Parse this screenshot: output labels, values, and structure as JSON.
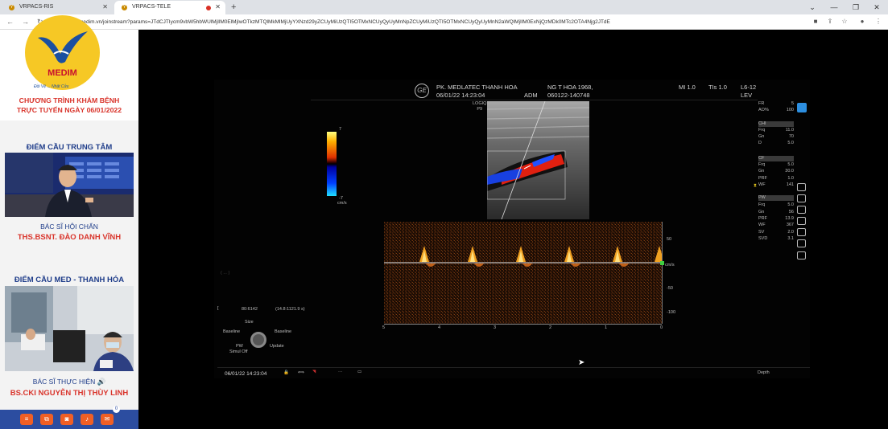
{
  "browser": {
    "tabs": [
      {
        "label": "VRPACS-RIS"
      },
      {
        "label": "VRPACS-TELE"
      }
    ],
    "url": "medim.vn/joinstream?params=JTdCJTIycm9vbW5hbWUlMjIlM0ElMjIwOTkzMTQlMkMlMjUyYXNzd29yZCUyMiUzQTI5OTMxNCUyQyUyMnNpZCUyMiUzQTI5OTMxNCUyQyUyMnN2aWQlMjIlM0ExNjQzMDk0MTc2OTA4Njg2JTdE"
  },
  "left_panel": {
    "logo_text": "MEDIM",
    "slogan": "Đồi Vệ ... Nhật Cửu",
    "program_line1": "CHƯƠNG TRÌNH KHÁM BỆNH",
    "program_line2": "TRỰC TUYẾN NGÀY 06/01/2022",
    "center_title": "ĐIỂM CẦU TRUNG TÂM",
    "center_role": "BÁC SĨ HỘI CHẨN",
    "center_doctor": "THS.BSNT. ĐÀO DANH VĨNH",
    "local_title": "ĐIỂM CẦU MED - THANH HÓA",
    "local_role": "BÁC SĨ THỰC HIỆN 🔊",
    "local_doctor": "BS.CKI NGUYỄN THỊ THÙY LINH",
    "chat_badge": "0"
  },
  "ultrasound": {
    "clinic": "PK. MEDLATEC THANH HOA",
    "datetime": "06/01/22 14:23:04",
    "operator": "ADM",
    "patient": "NG T HOA 1968,",
    "patient_id": "060122-140748",
    "mi": "MI 1.0",
    "tis": "TIs 1.0",
    "probe": "L6-12",
    "preset": "LEV",
    "logo_label": "LOGIQ\nP9",
    "params": [
      {
        "label": "FR",
        "value": "5"
      },
      {
        "label": "AO%",
        "value": "100"
      },
      {
        "label": "CHI",
        "value": ""
      },
      {
        "label": "Frq",
        "value": "11.0"
      },
      {
        "label": "Gn",
        "value": "70"
      },
      {
        "label": "D",
        "value": "5.0"
      },
      {
        "label": "CF",
        "value": ""
      },
      {
        "label": "Frq",
        "value": "5.0"
      },
      {
        "label": "Gn",
        "value": "30.0"
      },
      {
        "label": "PRF",
        "value": "1.0"
      },
      {
        "label": "WF",
        "value": "141"
      },
      {
        "label": "PW",
        "value": ""
      },
      {
        "label": "Frq",
        "value": "5.0"
      },
      {
        "label": "Gn",
        "value": "56"
      },
      {
        "label": "PRF",
        "value": "13.9"
      },
      {
        "label": "WF",
        "value": "367"
      },
      {
        "label": "SV",
        "value": "2.0"
      },
      {
        "label": "SVD",
        "value": "3.1"
      }
    ],
    "colorbar_top": "7",
    "colorbar_bottom": "-7",
    "colorbar_unit": "cm/s",
    "doppler_scale": [
      "50",
      "cm/s",
      "-50",
      "-100"
    ],
    "time_axis": [
      "5",
      "4",
      "3",
      "2",
      "1",
      "0"
    ],
    "cursor_info1": "80:6142",
    "cursor_info2": "(14.8:1121.9 s)",
    "faded_text": "( ... )",
    "knob": {
      "size": "Size",
      "baseline_l": "Baseline",
      "baseline_r": "Baseline",
      "pw": "PW",
      "simul": "Simul Off",
      "update": "Update"
    },
    "footer_time": "06/01/22 14:23:04",
    "brand": "Depth"
  }
}
